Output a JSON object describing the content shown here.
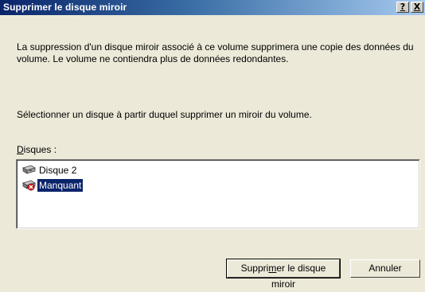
{
  "window": {
    "title": "Supprimer le disque miroir",
    "help_label": "?",
    "close_label": "X"
  },
  "content": {
    "description": "La suppression d'un disque miroir associé à ce volume supprimera une copie des données du volume. Le volume ne contiendra plus de données redondantes.",
    "instruction": "Sélectionner un disque à partir duquel supprimer un miroir du volume.",
    "disks_label_accel": "D",
    "disks_label_rest": "isques :"
  },
  "disks": [
    {
      "label": "Disque 2",
      "icon": "disk-icon",
      "selected": false
    },
    {
      "label": "Manquant",
      "icon": "missing-disk-icon",
      "selected": true
    }
  ],
  "buttons": {
    "remove_pre": "Suppri",
    "remove_accel": "m",
    "remove_post": "er le disque miroir",
    "cancel": "Annuler"
  },
  "colors": {
    "title_bar_start": "#0a246a",
    "title_bar_end": "#a6caf0",
    "selection": "#0a246a",
    "dialog_background": "#ece9d8"
  }
}
